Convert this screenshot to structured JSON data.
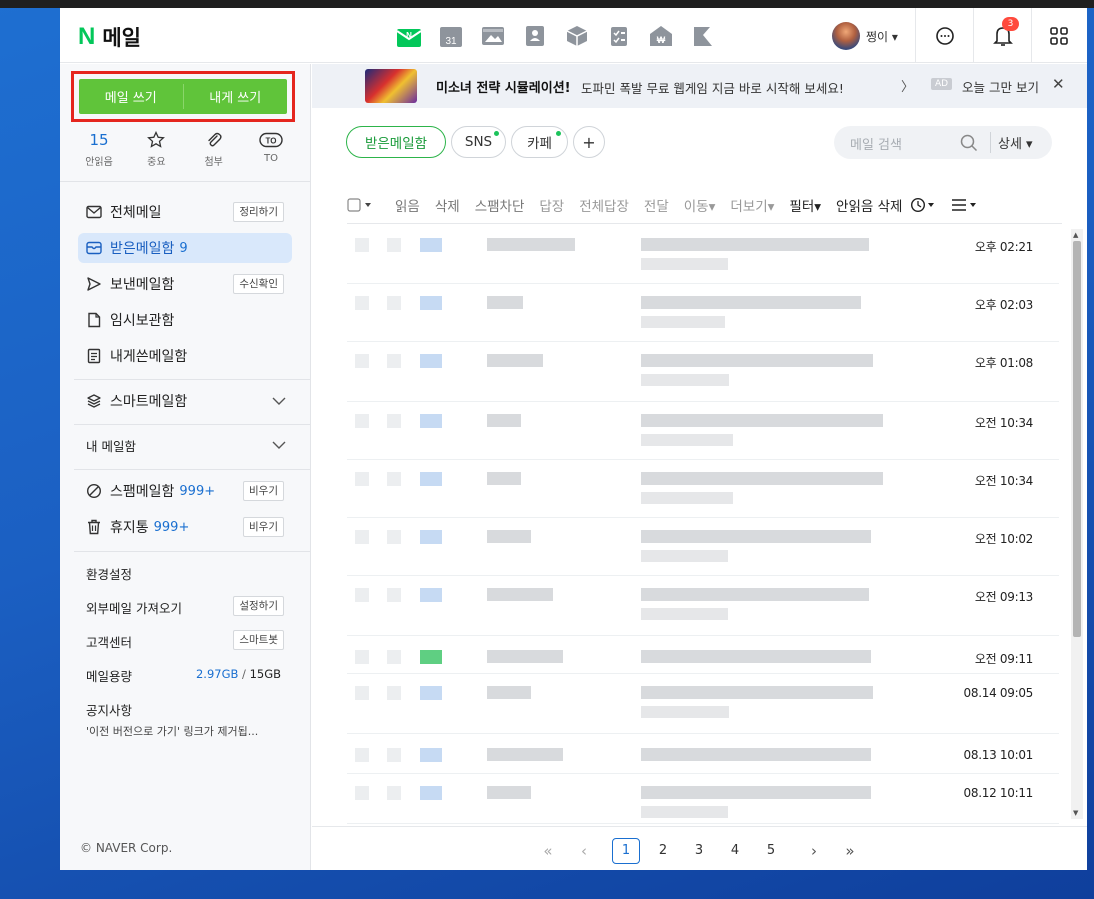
{
  "header": {
    "logo_letter": "N",
    "logo_text": "메일",
    "calendar_number": "31",
    "user_name": "쩡이 ▾",
    "notification_count": "3"
  },
  "sidebar": {
    "compose_label": "메일 쓰기",
    "self_compose_label": "내게 쓰기",
    "quick": [
      {
        "value": "15",
        "label": "안읽음"
      },
      {
        "icon": "star-icon",
        "label": "중요"
      },
      {
        "icon": "paperclip-icon",
        "label": "첨부"
      },
      {
        "icon": "to-icon",
        "icon_text": "TO",
        "label": "TO"
      }
    ],
    "folders": [
      {
        "label": "전체메일",
        "button": "정리하기",
        "icon": "mail-icon"
      },
      {
        "label": "받은메일함",
        "count": "9",
        "icon": "inbox-icon"
      },
      {
        "label": "보낸메일함",
        "button": "수신확인",
        "icon": "send-icon"
      },
      {
        "label": "임시보관함",
        "icon": "draft-icon"
      },
      {
        "label": "내게쓴메일함",
        "icon": "memo-icon"
      }
    ],
    "smart_box": "스마트메일함",
    "my_box": "내 메일함",
    "spam": {
      "label": "스팸메일함",
      "count": "999+",
      "button": "비우기"
    },
    "trash": {
      "label": "휴지통",
      "count": "999+",
      "button": "비우기"
    },
    "settings": "환경설정",
    "import": {
      "label": "외부메일 가져오기",
      "button": "설정하기"
    },
    "support": {
      "label": "고객센터",
      "button": "스마트봇"
    },
    "storage": {
      "label": "메일용량",
      "used": "2.97GB",
      "sep": "/",
      "total": "15GB"
    },
    "notice_title": "공지사항",
    "notice_text": "'이전 버전으로 가기' 링크가 제거됩...",
    "copyright": "© NAVER Corp."
  },
  "ad": {
    "title": "미소녀 전략 시뮬레이션!",
    "text": "도파민 폭발 무료 웹게임 지금 바로 시작해 보세요!",
    "chevron": "〉",
    "tag": "AD",
    "dismiss": "오늘 그만 보기",
    "close": "✕"
  },
  "tabs": {
    "inbox": "받은메일함",
    "sns": "SNS",
    "cafe": "카페",
    "add": "+"
  },
  "search": {
    "placeholder": "메일 검색",
    "advanced": "상세 ▾"
  },
  "toolbar": {
    "read": "읽음",
    "delete": "삭제",
    "spam_block": "스팸차단",
    "reply": "답장",
    "reply_all": "전체답장",
    "forward": "전달",
    "move": "이동▾",
    "more": "더보기▾",
    "filter": "필터▾",
    "delete_unread": "안읽음 삭제"
  },
  "mail_times": [
    "오후 02:21",
    "오후 02:03",
    "오후 01:08",
    "오전 10:34",
    "오전 10:34",
    "오전 10:02",
    "오전 09:13",
    "오전 09:11",
    "08.14 09:05",
    "08.13 10:01",
    "08.12 10:11"
  ],
  "pagination": {
    "first": "«",
    "prev": "‹",
    "pages": [
      "1",
      "2",
      "3",
      "4",
      "5"
    ],
    "next": "›",
    "last": "»"
  },
  "colors": {
    "accent": "#03c75a",
    "compose": "#60c43a",
    "highlight": "#e5261e",
    "selected": "#d9e8fb",
    "link": "#1a6fd0"
  }
}
